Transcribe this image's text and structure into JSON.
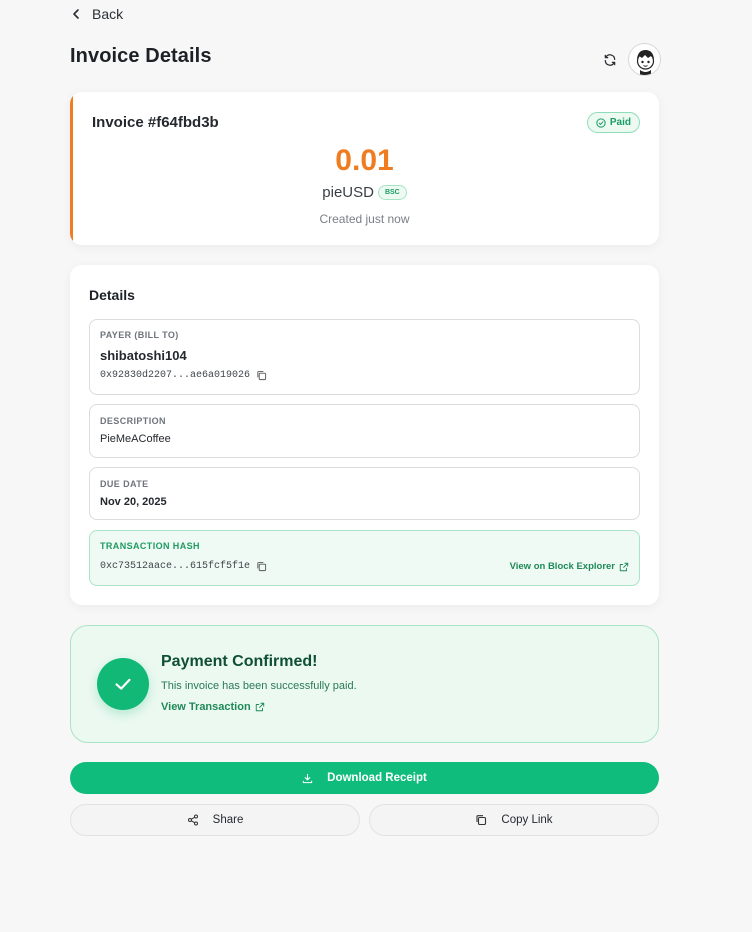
{
  "nav": {
    "back_label": "Back"
  },
  "header": {
    "title": "Invoice Details",
    "refresh_icon": "refresh-icon",
    "avatar_icon": "avatar"
  },
  "invoice": {
    "number": "Invoice #f64fbd3b",
    "status": "Paid",
    "amount": "0.01",
    "currency": "pieUSD",
    "network": "BSC",
    "created": "Created just now"
  },
  "details": {
    "title": "Details",
    "payer": {
      "label": "PAYER (BILL TO)",
      "name": "shibatoshi104",
      "address": "0x92830d2207...ae6a019026"
    },
    "description": {
      "label": "DESCRIPTION",
      "value": "PieMeACoffee"
    },
    "due_date": {
      "label": "DUE DATE",
      "value": "Nov 20, 2025"
    },
    "tx": {
      "label": "TRANSACTION HASH",
      "hash": "0xc73512aace...615fcf5f1e",
      "explorer_label": "View on Block Explorer"
    }
  },
  "confirmation": {
    "title": "Payment Confirmed!",
    "message": "This invoice has been successfully paid.",
    "link_label": "View Transaction"
  },
  "actions": {
    "download_label": "Download Receipt",
    "share_label": "Share",
    "copy_link_label": "Copy Link"
  },
  "colors": {
    "accent_orange": "#f07c22",
    "success_green": "#10bc7c",
    "success_dark": "#0f4f35",
    "background": "#f7f7f8"
  }
}
